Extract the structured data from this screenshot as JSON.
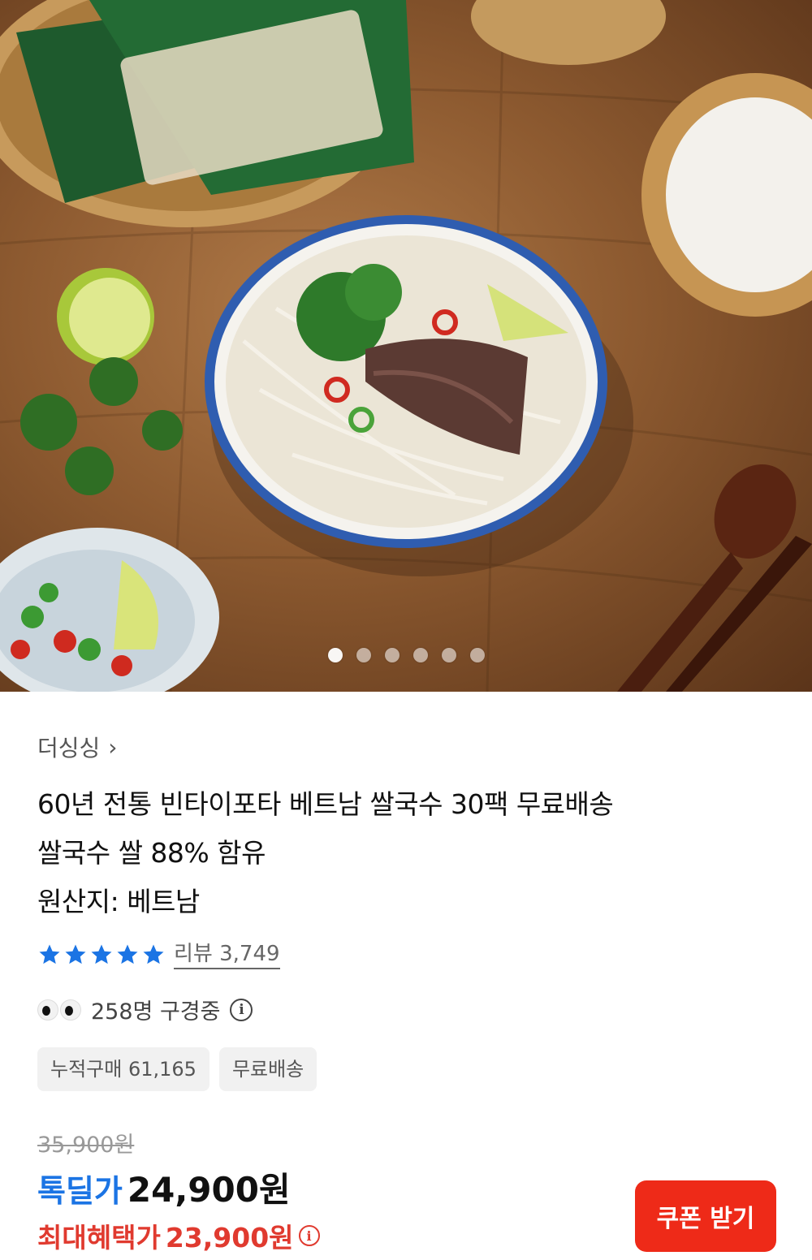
{
  "product": {
    "seller": "더싱싱",
    "title_lines": [
      "60년 전통 빈타이포타 베트남 쌀국수 30팩 무료배송",
      "쌀국수 쌀 88% 함유",
      "원산지: 베트남"
    ],
    "review_text": "리뷰 3,749",
    "rating_stars": 5,
    "viewing_text": "258명 구경중",
    "chips": [
      "누적구매 61,165",
      "무료배송"
    ],
    "original_price": "35,900원",
    "deal_label": "톡딜가",
    "deal_price": "24,900원",
    "max_benefit_label": "최대혜택가",
    "max_benefit_price": "23,900원",
    "coupon_button": "쿠폰 받기"
  },
  "carousel": {
    "total": 6,
    "current": 1
  },
  "colors": {
    "accent_blue": "#1b74e4",
    "accent_red": "#e03a2f",
    "button_red": "#ee2a18"
  }
}
